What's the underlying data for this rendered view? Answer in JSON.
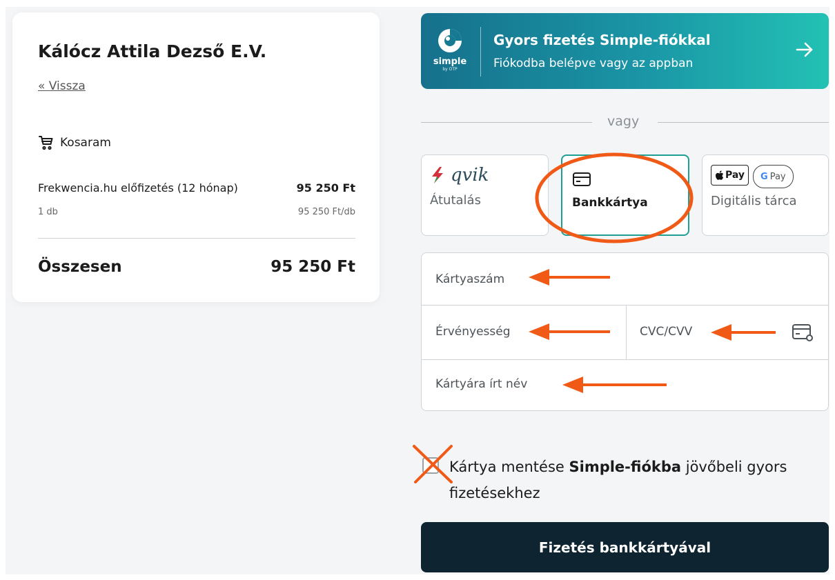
{
  "summary": {
    "merchant_name": "Kálócz Attila Dezső E.V.",
    "back_label": "« Vissza",
    "cart_label": "Kosaram",
    "item": {
      "name": "Frekwencia.hu előfizetés (12 hónap)",
      "price": "95 250 Ft",
      "quantity": "1 db",
      "unit_price": "95 250 Ft/db"
    },
    "total_label": "Összesen",
    "total_value": "95 250 Ft"
  },
  "simple_banner": {
    "logo_text": "simple",
    "logo_sub": "by OTP",
    "title": "Gyors fizetés Simple-fiókkal",
    "subtitle": "Fiókodba belépve vagy az appban",
    "arrow_icon": "arrow-right-icon"
  },
  "divider_text": "vagy",
  "payment_methods": {
    "qvik_logo": "qvik",
    "qvik_label": "Átutalás",
    "card_label": "Bankkártya",
    "apple_pay": "Pay",
    "google_pay": "Pay",
    "wallet_label": "Digitális tárca",
    "selected": "Bankkártya"
  },
  "form": {
    "card_number_placeholder": "Kártyaszám",
    "expiry_placeholder": "Érvényesség",
    "cvc_placeholder": "CVC/CVV",
    "name_placeholder": "Kártyára írt név"
  },
  "save_card": {
    "prefix": "Kártya mentése ",
    "bold": "Simple-fiókba",
    "suffix": " jövőbeli gyors fizetésekhez",
    "checked": false
  },
  "pay_button_label": "Fizetés bankkártyával",
  "colors": {
    "accent": "#1f9e93",
    "annotation": "#f05a16",
    "button_dark": "#0e2431"
  }
}
